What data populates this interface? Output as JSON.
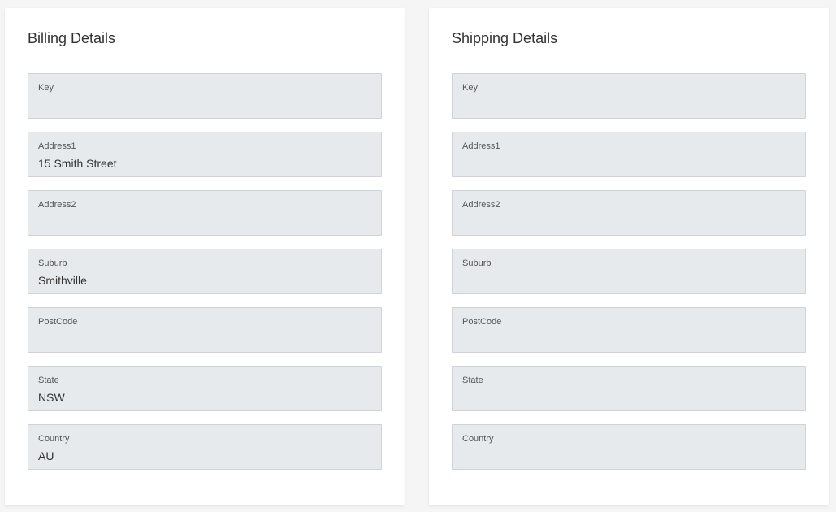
{
  "billing": {
    "title": "Billing Details",
    "fields": [
      {
        "label": "Key",
        "value": ""
      },
      {
        "label": "Address1",
        "value": "15 Smith Street"
      },
      {
        "label": "Address2",
        "value": ""
      },
      {
        "label": "Suburb",
        "value": "Smithville"
      },
      {
        "label": "PostCode",
        "value": ""
      },
      {
        "label": "State",
        "value": "NSW"
      },
      {
        "label": "Country",
        "value": "AU"
      }
    ]
  },
  "shipping": {
    "title": "Shipping Details",
    "fields": [
      {
        "label": "Key",
        "value": ""
      },
      {
        "label": "Address1",
        "value": ""
      },
      {
        "label": "Address2",
        "value": ""
      },
      {
        "label": "Suburb",
        "value": ""
      },
      {
        "label": "PostCode",
        "value": ""
      },
      {
        "label": "State",
        "value": ""
      },
      {
        "label": "Country",
        "value": ""
      }
    ]
  },
  "colors": {
    "page_background": "#f5f5f5",
    "card_background": "#ffffff",
    "field_background": "#e7eaed",
    "field_border": "#cfd3d7"
  }
}
